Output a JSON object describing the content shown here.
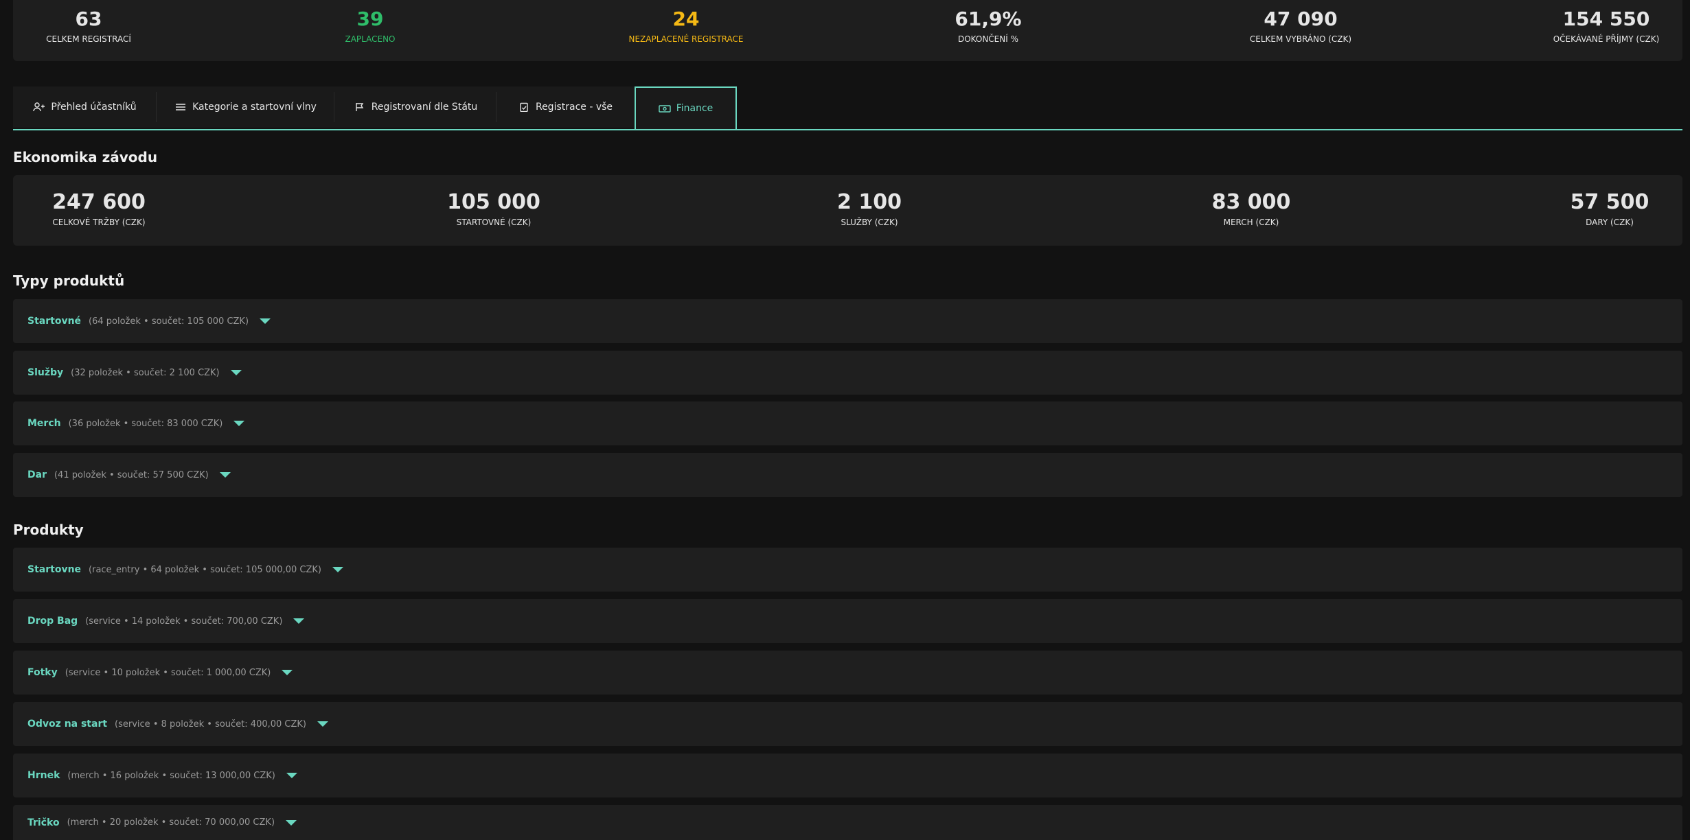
{
  "summary": [
    {
      "value": "63",
      "label": "CELKEM REGISTRACÍ",
      "color": "#e6e6e6"
    },
    {
      "value": "39",
      "label": "ZAPLACENO",
      "color": "#2fbe6a"
    },
    {
      "value": "24",
      "label": "NEZAPLACENÉ REGISTRACE",
      "color": "#f5b915"
    },
    {
      "value": "61,9%",
      "label": "DOKONČENÍ %",
      "color": "#e6e6e6"
    },
    {
      "value": "47 090",
      "label": "CELKEM VYBRÁNO (CZK)",
      "color": "#e6e6e6"
    },
    {
      "value": "154 550",
      "label": "OČEKÁVANÉ PŘÍJMY (CZK)",
      "color": "#e6e6e6"
    }
  ],
  "tabs": [
    {
      "label": "Přehled účastníků",
      "icon": "users-icon"
    },
    {
      "label": "Kategorie a startovní vlny",
      "icon": "list-icon"
    },
    {
      "label": "Registrovaní dle Státu",
      "icon": "flag-icon"
    },
    {
      "label": "Registrace - vše",
      "icon": "clipboard-check-icon"
    },
    {
      "label": "Finance",
      "icon": "money-icon",
      "active": true
    }
  ],
  "economy": {
    "title": "Ekonomika závodu",
    "stats": [
      {
        "value": "247 600",
        "label": "CELKOVÉ TRŽBY (CZK)"
      },
      {
        "value": "105 000",
        "label": "STARTOVNÉ (CZK)"
      },
      {
        "value": "2 100",
        "label": "SLUŽBY (CZK)"
      },
      {
        "value": "83 000",
        "label": "MERCH (CZK)"
      },
      {
        "value": "57 500",
        "label": "DARY (CZK)"
      }
    ]
  },
  "product_types": {
    "title": "Typy produktů",
    "items": [
      {
        "name": "Startovné",
        "meta": "(64 položek • součet: 105 000 CZK)"
      },
      {
        "name": "Služby",
        "meta": "(32 položek • součet: 2 100 CZK)"
      },
      {
        "name": "Merch",
        "meta": "(36 položek • součet: 83 000 CZK)"
      },
      {
        "name": "Dar",
        "meta": "(41 položek • součet: 57 500 CZK)"
      }
    ]
  },
  "products": {
    "title": "Produkty",
    "items": [
      {
        "name": "Startovne",
        "meta": "(race_entry • 64 položek • součet: 105 000,00 CZK)"
      },
      {
        "name": "Drop Bag",
        "meta": "(service • 14 položek • součet: 700,00 CZK)"
      },
      {
        "name": "Fotky",
        "meta": "(service • 10 položek • součet: 1 000,00 CZK)"
      },
      {
        "name": "Odvoz na start",
        "meta": "(service • 8 položek • součet: 400,00 CZK)"
      },
      {
        "name": "Hrnek",
        "meta": "(merch • 16 položek • součet: 13 000,00 CZK)"
      },
      {
        "name": "Tričko",
        "meta": "(merch • 20 položek • součet: 70 000,00 CZK)"
      }
    ]
  },
  "accent": "#6ad7c0"
}
